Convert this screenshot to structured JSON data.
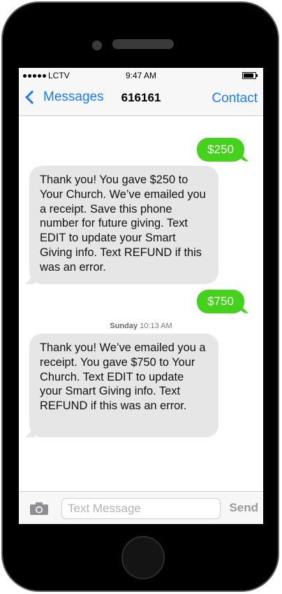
{
  "status_bar": {
    "carrier": "LCTV",
    "time": "9:47 AM"
  },
  "nav": {
    "back_label": "Messages",
    "title": "616161",
    "right_label": "Contact"
  },
  "messages": [
    {
      "direction": "outgoing",
      "text": "$250"
    },
    {
      "direction": "incoming",
      "text": "Thank you! You gave $250 to Your Church. We’ve emailed you a receipt. Save this phone number for future giving. Text EDIT to update your Smart Giving info. Text REFUND if this was an error."
    },
    {
      "direction": "outgoing",
      "text": "$750"
    },
    {
      "direction": "incoming",
      "text": "Thank you! We’ve emailed you a receipt. You gave $750 to Your Church. Text EDIT to update your Smart Giving info. Text REFUND if this was an error."
    }
  ],
  "timestamp": {
    "day": "Sunday",
    "time": "10:13 AM"
  },
  "composer": {
    "placeholder": "Text Message",
    "send_label": "Send"
  },
  "colors": {
    "accent": "#1a7cf5",
    "outgoing_bubble": "#45d11e",
    "incoming_bubble": "#e6e6e6"
  },
  "icons": {
    "back": "chevron-left-icon",
    "camera": "camera-icon",
    "battery": "battery-icon",
    "signal": "signal-dots-icon"
  }
}
